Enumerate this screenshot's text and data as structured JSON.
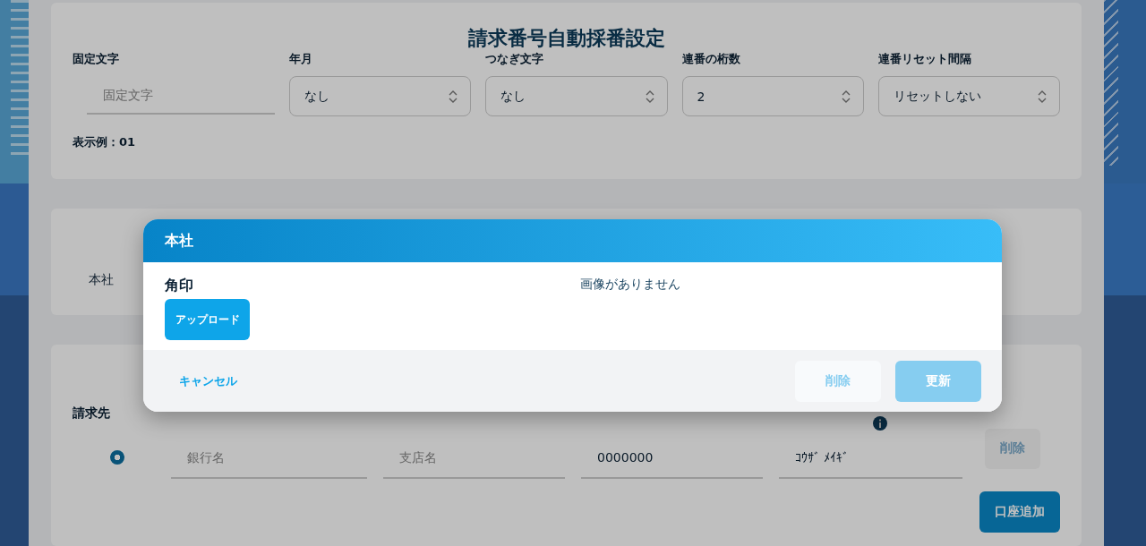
{
  "numbering": {
    "title": "請求番号自動採番設定",
    "fields": [
      {
        "kind": "text",
        "label": "固定文字",
        "placeholder": "固定文字"
      },
      {
        "kind": "select",
        "label": "年月",
        "value": "なし"
      },
      {
        "kind": "select",
        "label": "つなぎ文字",
        "value": "なし"
      },
      {
        "kind": "select",
        "label": "連番の桁数",
        "value": "2"
      },
      {
        "kind": "select",
        "label": "連番リセット間隔",
        "value": "リセットしない"
      }
    ],
    "example": "表示例：01"
  },
  "office": {
    "label": "本社"
  },
  "billing": {
    "label": "請求先",
    "accounts": [
      {
        "selected": true,
        "fields": [
          {
            "placeholder": "銀行名"
          },
          {
            "placeholder": "支店名"
          },
          {
            "value": "0000000"
          },
          {
            "value": "ｺｳｻﾞ ﾒｲｷﾞ"
          }
        ],
        "delete": {
          "label": "削除",
          "disabled": true
        }
      }
    ],
    "add_button": "口座追加"
  },
  "dialog": {
    "title": "本社",
    "stamp_label": "角印",
    "upload_button": "アップロード",
    "image_status": "画像がありません",
    "cancel": "キャンセル",
    "delete": {
      "label": "削除",
      "disabled": true
    },
    "update": {
      "label": "更新",
      "disabled": true
    }
  }
}
